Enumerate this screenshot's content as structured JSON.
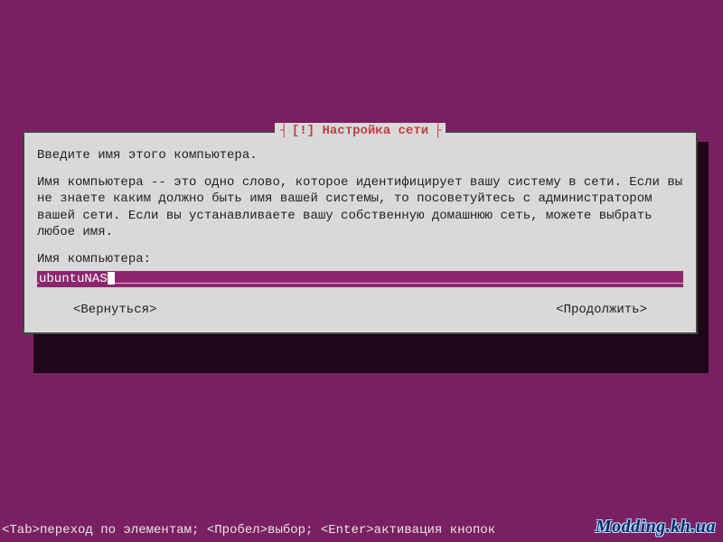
{
  "dialog": {
    "title_decor_left": "┤ ",
    "title_prefix": "[!] ",
    "title": "Настройка сети",
    "title_decor_right": " ├",
    "intro": "Введите имя этого компьютера.",
    "desc": "Имя компьютера -- это одно слово, которое идентифицирует вашу систему в сети. Если вы не знаете каким должно быть имя вашей системы, то посоветуйтесь с администратором вашей сети. Если вы устанавливаете вашу собственную домашнюю сеть, можете выбрать любое имя.",
    "field_label": "Имя компьютера:",
    "field_value": "ubuntuNAS",
    "back_label": "<Вернуться>",
    "continue_label": "<Продолжить>"
  },
  "statusbar": "<Tab>переход по элементам; <Пробел>выбор; <Enter>активация кнопок",
  "watermark": "Modding.kh.ua",
  "colors": {
    "bg": "#7a2062",
    "panel": "#d9d9d9",
    "accent": "#8e266f",
    "title": "#c33e3e"
  }
}
